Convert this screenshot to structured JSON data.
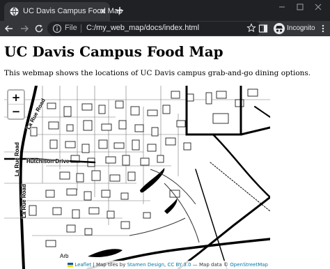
{
  "browser": {
    "tab_title": "UC Davis Campus Food Map",
    "url_scheme_label": "File",
    "url": "C:/my_web_map/docs/index.html",
    "profile_label": "Incognito",
    "icons": [
      "globe-icon",
      "close-icon",
      "plus-icon",
      "back-icon",
      "forward-icon",
      "reload-icon",
      "info-icon",
      "star-icon",
      "side-panel-icon",
      "incognito-icon",
      "kebab-menu-icon",
      "minimize-icon",
      "maximize-icon",
      "window-close-icon"
    ]
  },
  "page": {
    "title": "UC Davis Campus Food Map",
    "description": "This webmap shows the locations of UC Davis campus grab-and-go dining options."
  },
  "map": {
    "zoom_in_label": "+",
    "zoom_out_label": "−",
    "road_labels": {
      "hutchison": "Hutchison Drive",
      "la_rue_1": "La Rue Road",
      "la_rue_2": "La Rue Road",
      "la_rue_3": "La Rue Road",
      "arb": "Arb"
    },
    "attribution": {
      "leaflet": "Leaflet",
      "tiles_prefix": "| Map tiles by",
      "stamen": "Stamen Design",
      "license": "CC BY 3.0",
      "data_prefix": "— Map data ©",
      "osm": "OpenStreetMap"
    }
  },
  "colors": {
    "chrome_dark": "#202124",
    "chrome_tab": "#35363a",
    "chrome_text": "#e8eaed",
    "link": "#0078a8"
  }
}
